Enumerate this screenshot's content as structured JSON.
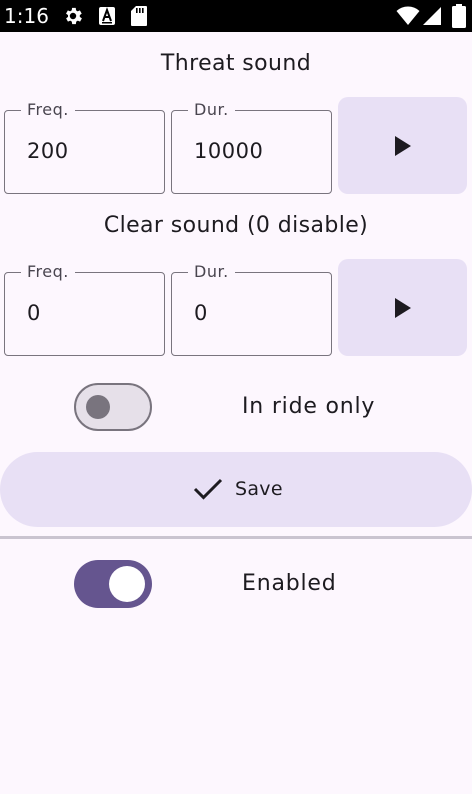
{
  "status_bar": {
    "time": "1:16",
    "icons": [
      "gear-icon",
      "a-badge-icon",
      "sd-card-icon",
      "wifi-icon",
      "signal-icon",
      "battery-icon"
    ]
  },
  "threat": {
    "title": "Threat sound",
    "freq_label": "Freq.",
    "freq_value": "200",
    "dur_label": "Dur.",
    "dur_value": "10000",
    "play_icon": "play-icon"
  },
  "clear": {
    "title": "Clear sound (0 disable)",
    "freq_label": "Freq.",
    "freq_value": "0",
    "dur_label": "Dur.",
    "dur_value": "0",
    "play_icon": "play-icon"
  },
  "ride_only": {
    "label": "In ride only",
    "checked": false
  },
  "save": {
    "label": "Save",
    "icon": "check-icon"
  },
  "enabled": {
    "label": "Enabled",
    "checked": true
  },
  "colors": {
    "background": "#FDF7FE",
    "primary": "#65558F",
    "tonal_container": "#E8E0F5",
    "outline": "#79747E",
    "on_surface": "#1D1B20",
    "status_bar": "#000000"
  }
}
